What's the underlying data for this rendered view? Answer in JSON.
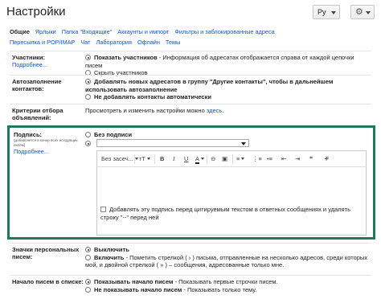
{
  "header": {
    "title": "Настройки",
    "lang_label": "Ру",
    "gear_icon": "gear-icon"
  },
  "tabs": [
    {
      "label": "Общие",
      "active": true
    },
    {
      "label": "Ярлыки"
    },
    {
      "label": "Папка \"Входящие\""
    },
    {
      "label": "Аккаунты и импорт"
    },
    {
      "label": "Фильтры и заблокированные адреса"
    },
    {
      "label": "Пересылка и POP/IMAP"
    },
    {
      "label": "Чат"
    },
    {
      "label": "Лаборатория"
    },
    {
      "label": "Офлайн"
    },
    {
      "label": "Темы"
    }
  ],
  "participants": {
    "label": "Участники:",
    "more": "Подробнее...",
    "opt1_bold": "Показать участников",
    "opt1_desc": " - Информация об адресатах отображается справа от каждой цепочки писем",
    "opt2": "Скрыть участников"
  },
  "autocomplete": {
    "label": "Автозаполнение контактов:",
    "opt1_bold": "Добавлять новых адресатов в группу \"Другие контакты\", чтобы в дальнейшем использовать автозаполнение",
    "opt2_bold": "Не добавлять контакты автоматически"
  },
  "criteria": {
    "label": "Критерии отбора объявлений:",
    "text": "Просмотреть и изменить настройки можно ",
    "link": "здесь",
    "end": "."
  },
  "signature": {
    "label": "Подпись:",
    "note": "(добавляется в конце всех исходящих писем)",
    "more": "Подробнее...",
    "none_opt": "Без подписи",
    "font_label": "Без засеч...",
    "checkbox_text": "Добавлять эту подпись перед цитируемым текстом в ответных сообщениях и удалять строку \"--\" перед ней"
  },
  "badges": {
    "label": "Значки персональных писем:",
    "opt1_bold": "Выключить",
    "opt2_bold": "Включить",
    "opt2_desc": " - Пометить стрелкой ( › ) письма, отправленные на несколько адресов, среди которых мой, и двойной стрелкой ( » ) – сообщения, адресованные только мне."
  },
  "snippets": {
    "label": "Начало писем в списке:",
    "opt1_bold": "Показывать начало писем",
    "opt1_desc": " - Показывать первые строчки писем.",
    "opt2_bold": "Не показывать начало писем",
    "opt2_desc": " - Показывать только тему."
  }
}
